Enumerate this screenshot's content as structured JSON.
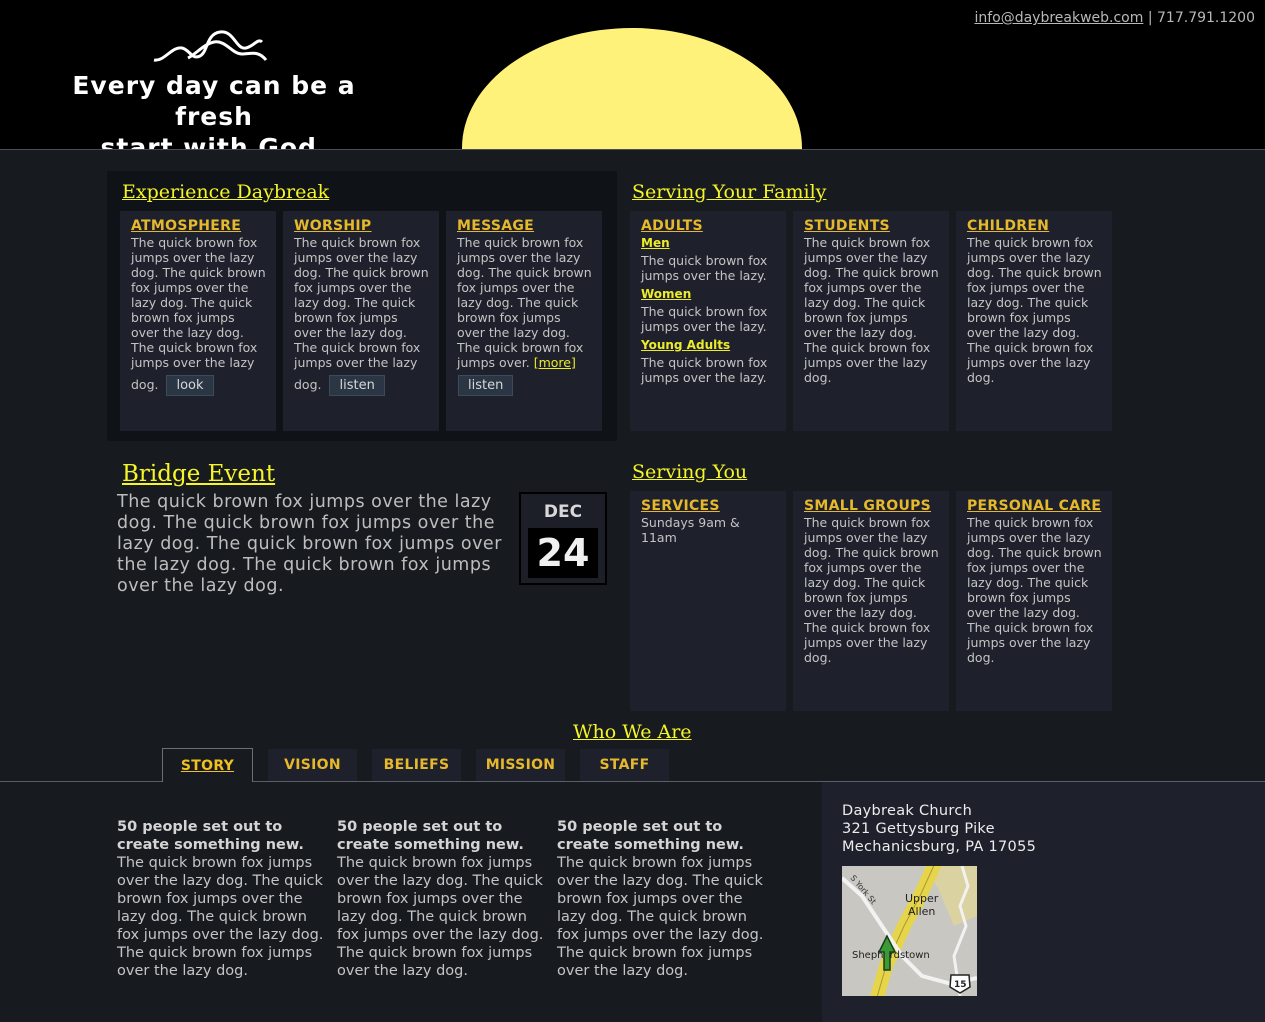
{
  "header": {
    "email": "info@daybreakweb.com",
    "separator": "|",
    "phone": "717.791.1200",
    "tagline_line1": "Every day can be a fresh",
    "tagline_line2": "start with God."
  },
  "experience": {
    "title": "Experience Daybreak",
    "cards": [
      {
        "heading": "ATMOSPHERE",
        "text": "The quick brown fox jumps over the lazy dog. The quick brown fox jumps over the lazy dog. The quick brown fox jumps over the lazy dog. The quick brown fox jumps over the lazy",
        "tail": "dog.",
        "button": "look"
      },
      {
        "heading": "WORSHIP",
        "text": "The quick brown fox jumps over the lazy dog. The quick brown fox jumps over the lazy dog. The quick brown fox jumps over the lazy dog. The quick brown fox jumps over the lazy",
        "tail": "dog.",
        "button": "listen"
      },
      {
        "heading": "MESSAGE",
        "text": "The quick brown fox jumps over the lazy dog. The quick brown fox jumps over the lazy dog. The quick brown fox jumps over the lazy dog. The quick brown fox jumps over.",
        "more": "[more]",
        "button": "listen"
      }
    ]
  },
  "family": {
    "title": "Serving Your Family",
    "adults": {
      "heading": "ADULTS",
      "groups": [
        {
          "name": "Men",
          "text": "The quick brown fox jumps over the lazy."
        },
        {
          "name": "Women",
          "text": "The quick brown fox jumps over the lazy."
        },
        {
          "name": "Young Adults",
          "text": "The quick brown fox jumps over the lazy."
        }
      ]
    },
    "students": {
      "heading": "STUDENTS",
      "text": "The quick brown fox jumps over the lazy dog. The quick brown fox jumps over the lazy dog. The quick brown fox jumps over the lazy dog. The quick brown fox jumps over the lazy dog."
    },
    "children": {
      "heading": "CHILDREN",
      "text": "The quick brown fox jumps over the lazy dog. The quick brown fox jumps over the lazy dog. The quick brown fox jumps over the lazy dog. The quick brown fox jumps over the lazy dog."
    }
  },
  "bridge": {
    "title": "Bridge Event",
    "text": "The quick brown fox jumps over the lazy dog. The quick brown fox jumps over the lazy dog. The quick brown fox jumps over the lazy dog. The quick brown fox jumps over the lazy dog.",
    "month": "DEC",
    "day": "24"
  },
  "serving": {
    "title": "Serving You",
    "services": {
      "heading": "SERVICES",
      "text": "Sundays 9am & 11am"
    },
    "small_groups": {
      "heading": "SMALL GROUPS",
      "text": "The quick brown fox jumps over the lazy dog. The quick brown fox jumps over the lazy dog. The quick brown fox jumps over the lazy dog. The quick brown fox jumps over the lazy dog."
    },
    "personal_care": {
      "heading": "PERSONAL CARE",
      "text": "The quick brown fox jumps over the lazy dog. The quick brown fox jumps over the lazy dog. The quick brown fox jumps over the lazy dog. The quick brown fox jumps over the lazy dog."
    }
  },
  "who": {
    "title": "Who We Are",
    "tabs": [
      "STORY",
      "VISION",
      "BELIEFS",
      "MISSION",
      "STAFF"
    ],
    "active_tab": "STORY",
    "columns": [
      {
        "lead": "50 people set out to create something new.",
        "text": " The quick brown fox jumps over the lazy dog. The quick brown fox jumps over the lazy dog. The quick brown fox jumps over the lazy dog. The quick brown fox jumps over the lazy dog."
      },
      {
        "lead": "50 people set out to create something new.",
        "text": " The quick brown fox jumps over the lazy dog. The quick brown fox jumps over the lazy dog. The quick brown fox jumps over the lazy dog. The quick brown fox jumps over the lazy dog."
      },
      {
        "lead": "50 people set out to create something new.",
        "text": " The quick brown fox jumps over the lazy dog. The quick brown fox jumps over the lazy dog. The quick brown fox jumps over the lazy dog. The quick brown fox jumps over the lazy dog."
      }
    ]
  },
  "address": {
    "name": "Daybreak Church",
    "street": "321 Gettysburg Pike",
    "city": "Mechanicsburg, PA 17055"
  },
  "map": {
    "label_street": "S York St",
    "label_area1": "Upper",
    "label_area2": "Allen",
    "label_town": "Shepherdstown",
    "route": "15"
  },
  "colors": {
    "accent_yellow": "#f5f528",
    "heading_gold": "#e6b92c",
    "sun": "#fff27a",
    "panel": "#1e212b",
    "background": "#171b20"
  }
}
